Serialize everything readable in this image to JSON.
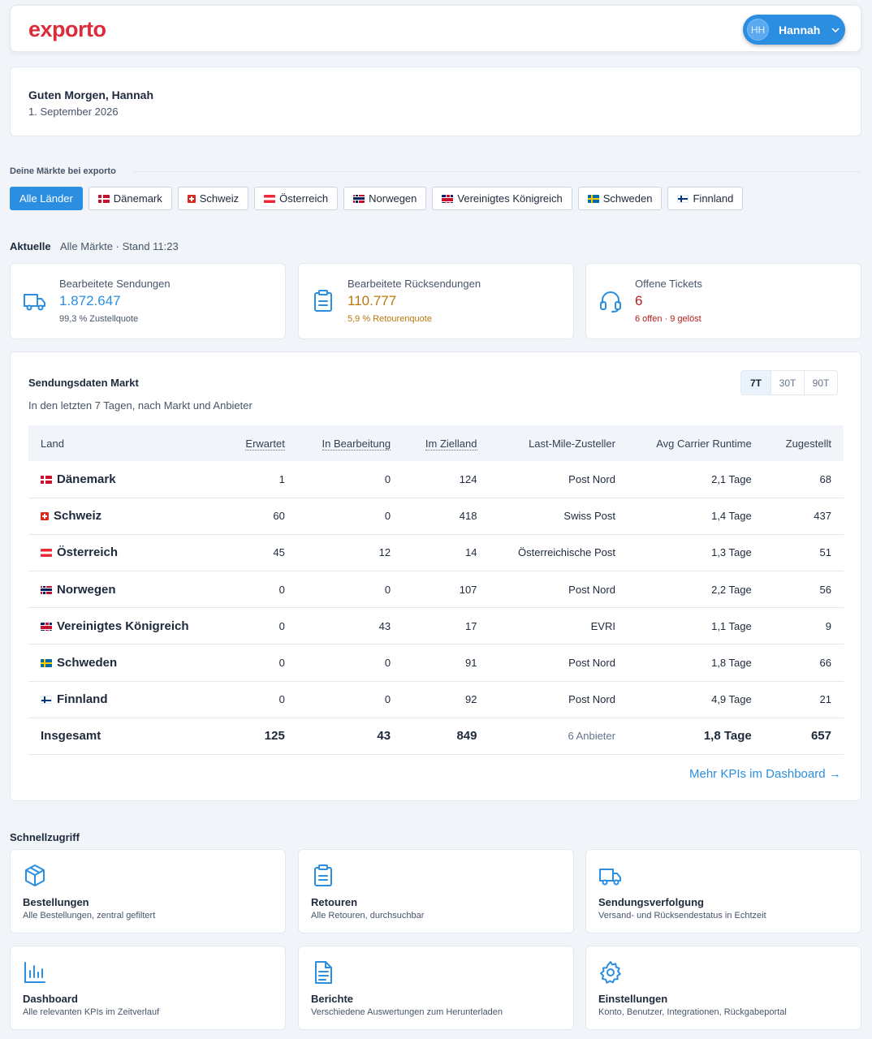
{
  "header": {
    "logo": "exporto",
    "user": {
      "initials": "HH",
      "name": "Hannah"
    }
  },
  "greeting": {
    "title": "Guten Morgen, Hannah",
    "date": "1. September 2026"
  },
  "markets": {
    "label": "Deine Märkte bei exporto",
    "chips": [
      {
        "label": "Alle Länder",
        "flag": "",
        "active": true
      },
      {
        "label": "Dänemark",
        "flag": "dk"
      },
      {
        "label": "Schweiz",
        "flag": "ch"
      },
      {
        "label": "Österreich",
        "flag": "at"
      },
      {
        "label": "Norwegen",
        "flag": "no"
      },
      {
        "label": "Vereinigtes Königreich",
        "flag": "gb"
      },
      {
        "label": "Schweden",
        "flag": "se"
      },
      {
        "label": "Finnland",
        "flag": "fi"
      }
    ]
  },
  "current": {
    "title": "Aktuelle",
    "subtitle": "Alle Märkte · Stand 11:23",
    "kpis": [
      {
        "label": "Bearbeitete Sendungen",
        "value": "1.872.647",
        "sub": "99,3 % Zustellquote",
        "color": "#2b8ee0",
        "sub_color": "#475569",
        "icon": "truck-icon"
      },
      {
        "label": "Bearbeitete Rücksendungen",
        "value": "110.777",
        "sub": "5,9 % Retourenquote",
        "color": "#b9770e",
        "sub_color": "#b9770e",
        "icon": "clipboard-icon"
      },
      {
        "label": "Offene Tickets",
        "value": "6",
        "sub": "6 offen · 9 gelöst",
        "color": "#b91c1c",
        "sub_color": "#b91c1c",
        "icon": "headset-icon"
      }
    ]
  },
  "table": {
    "title": "Sendungsdaten Markt",
    "subtitle": "In den letzten 7 Tagen, nach Markt und Anbieter",
    "ranges": [
      "7T",
      "30T",
      "90T"
    ],
    "active_range": "7T",
    "columns": [
      "Land",
      "Erwartet",
      "In Bearbeitung",
      "Im Zielland",
      "Last-Mile-Zusteller",
      "Avg Carrier Runtime",
      "Zugestellt"
    ],
    "rows": [
      {
        "flag": "dk",
        "land": "Dänemark",
        "erwartet": "1",
        "bearbeitung": "0",
        "zielland": "124",
        "zusteller": "Post Nord",
        "runtime": "2,1 Tage",
        "zugestellt": "68"
      },
      {
        "flag": "ch",
        "land": "Schweiz",
        "erwartet": "60",
        "bearbeitung": "0",
        "zielland": "418",
        "zusteller": "Swiss Post",
        "runtime": "1,4 Tage",
        "zugestellt": "437"
      },
      {
        "flag": "at",
        "land": "Österreich",
        "erwartet": "45",
        "bearbeitung": "12",
        "zielland": "14",
        "zusteller": "Österreichische Post",
        "runtime": "1,3 Tage",
        "zugestellt": "51"
      },
      {
        "flag": "no",
        "land": "Norwegen",
        "erwartet": "0",
        "bearbeitung": "0",
        "zielland": "107",
        "zusteller": "Post Nord",
        "runtime": "2,2 Tage",
        "zugestellt": "56"
      },
      {
        "flag": "gb",
        "land": "Vereinigtes Königreich",
        "erwartet": "0",
        "bearbeitung": "43",
        "zielland": "17",
        "zusteller": "EVRI",
        "runtime": "1,1 Tage",
        "zugestellt": "9"
      },
      {
        "flag": "se",
        "land": "Schweden",
        "erwartet": "0",
        "bearbeitung": "0",
        "zielland": "91",
        "zusteller": "Post Nord",
        "runtime": "1,8 Tage",
        "zugestellt": "66"
      },
      {
        "flag": "fi",
        "land": "Finnland",
        "erwartet": "0",
        "bearbeitung": "0",
        "zielland": "92",
        "zusteller": "Post Nord",
        "runtime": "4,9 Tage",
        "zugestellt": "21"
      }
    ],
    "total": {
      "land": "Insgesamt",
      "erwartet": "125",
      "bearbeitung": "43",
      "zielland": "849",
      "zusteller": "6 Anbieter",
      "runtime": "1,8 Tage",
      "zugestellt": "657"
    },
    "more_link": "Mehr KPIs im Dashboard →"
  },
  "quick": {
    "title": "Schnellzugriff",
    "items": [
      {
        "label": "Bestellungen",
        "sub": "Alle Bestellungen, zentral gefiltert",
        "icon": "box-icon"
      },
      {
        "label": "Retouren",
        "sub": "Alle Retouren, durchsuchbar",
        "icon": "clipboard-icon"
      },
      {
        "label": "Sendungsverfolgung",
        "sub": "Versand- und Rücksendestatus in Echtzeit",
        "icon": "truck-icon"
      },
      {
        "label": "Dashboard",
        "sub": "Alle relevanten KPIs im Zeitverlauf",
        "icon": "bar-chart-icon"
      },
      {
        "label": "Berichte",
        "sub": "Verschiedene Auswertungen zum Herunterladen",
        "icon": "document-icon"
      },
      {
        "label": "Einstellungen",
        "sub": "Konto, Benutzer, Integrationen, Rückgabeportal",
        "icon": "gear-icon"
      }
    ]
  }
}
